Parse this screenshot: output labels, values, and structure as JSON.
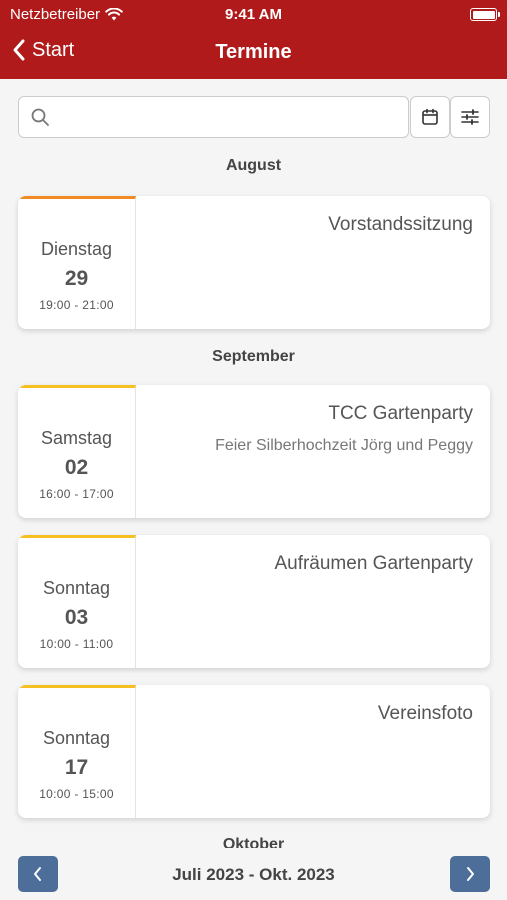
{
  "status": {
    "carrier": "Netzbetreiber",
    "time": "9:41 AM"
  },
  "nav": {
    "back_label": "Start",
    "title": "Termine"
  },
  "search": {
    "placeholder": "",
    "value": ""
  },
  "months": [
    "August",
    "September",
    "Oktober"
  ],
  "events": [
    {
      "weekday": "Dienstag",
      "day": "29",
      "time": "19:00 - 21:00",
      "title": "Vorstandssitzung",
      "subtitle": "",
      "accent": "#f08a24"
    },
    {
      "weekday": "Samstag",
      "day": "02",
      "time": "16:00 - 17:00",
      "title": "TCC Gartenparty",
      "subtitle": "Feier Silberhochzeit Jörg und Peggy",
      "accent": "#f5c022"
    },
    {
      "weekday": "Sonntag",
      "day": "03",
      "time": "10:00 - 11:00",
      "title": "Aufräumen Gartenparty",
      "subtitle": "",
      "accent": "#f5c022"
    },
    {
      "weekday": "Sonntag",
      "day": "17",
      "time": "10:00 - 15:00",
      "title": "Vereinsfoto",
      "subtitle": "",
      "accent": "#f5c022"
    }
  ],
  "footer": {
    "range": "Juli 2023 - Okt. 2023"
  },
  "colors": {
    "brand": "#b01a1a",
    "pager": "#4d6e99"
  },
  "icons": [
    "wifi-icon",
    "battery-icon",
    "chevron-left-icon",
    "search-icon",
    "calendar-icon",
    "sliders-icon",
    "chevron-right-icon"
  ]
}
